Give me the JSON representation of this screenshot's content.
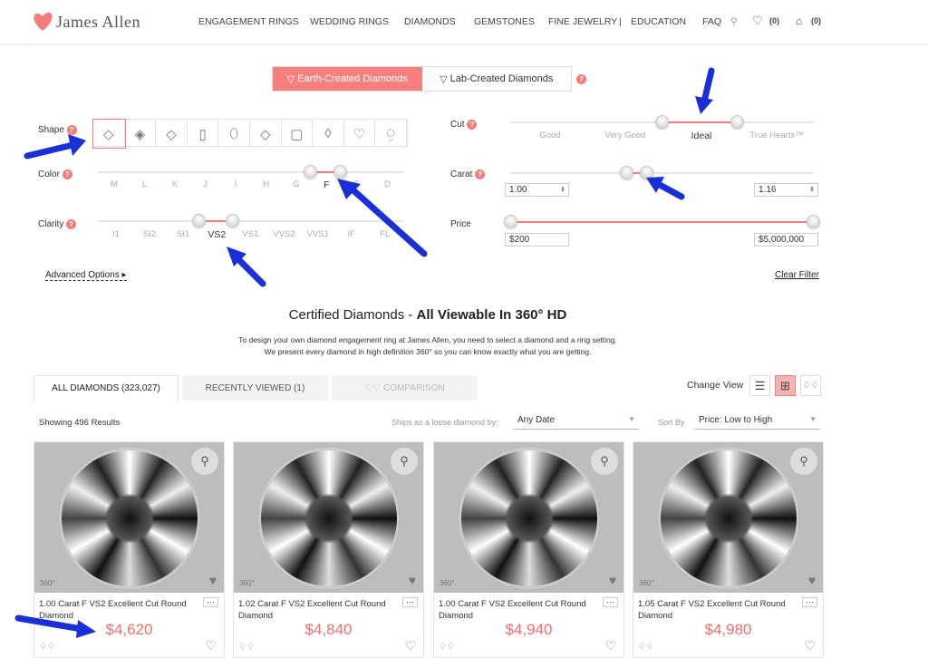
{
  "header": {
    "logo": "James Allen",
    "nav": [
      "ENGAGEMENT RINGS",
      "WEDDING RINGS",
      "DIAMONDS",
      "GEMSTONES",
      "FINE JEWELRY",
      "|",
      "EDUCATION",
      "FAQ"
    ],
    "wishlist_count": "(0)",
    "cart_count": "(0)"
  },
  "toggle": {
    "earth": "Earth-Created Diamonds",
    "lab": "Lab-Created Diamonds",
    "selected": "earth"
  },
  "filters": {
    "shape": {
      "label": "Shape",
      "selected": "Round",
      "icons": [
        "round",
        "princess",
        "cushion",
        "emerald",
        "oval",
        "asscher",
        "radiant",
        "marquise",
        "heart",
        "pear"
      ]
    },
    "color": {
      "label": "Color",
      "ticks": [
        "M",
        "L",
        "K",
        "J",
        "I",
        "H",
        "G",
        "F",
        "E",
        "D"
      ],
      "active": "F",
      "range": [
        "F",
        "F"
      ]
    },
    "clarity": {
      "label": "Clarity",
      "ticks": [
        "I1",
        "SI2",
        "SI1",
        "VS2",
        "VS1",
        "VVS2",
        "VVS1",
        "IF",
        "FL"
      ],
      "active": "VS2",
      "range": [
        "VS2",
        "VS2"
      ]
    },
    "cut": {
      "label": "Cut",
      "ticks": [
        "Good",
        "Very Good",
        "Ideal",
        "True Hearts™"
      ],
      "active": "Ideal"
    },
    "carat": {
      "label": "Carat",
      "min": "1.00",
      "max": "1.16"
    },
    "price": {
      "label": "Price",
      "min": "$200",
      "max": "$5,000,000"
    },
    "advanced": "Advanced Options ▸",
    "clear": "Clear Filter"
  },
  "section": {
    "title_plain": "Certified Diamonds - ",
    "title_bold": "All Viewable In 360° HD",
    "desc1": "To design your own diamond engagement ring at James Allen, you need to select a diamond and a ring setting.",
    "desc2": "We present every diamond in high definition 360° so you can know exactly what you are getting."
  },
  "tabs": [
    "ALL DIAMONDS (323,027)",
    "RECENTLY VIEWED (1)",
    "♡♡ COMPARISON"
  ],
  "view": {
    "label": "Change View",
    "selected": "grid"
  },
  "results": {
    "showing": "Showing 496 Results",
    "ships_label": "Ships as a loose diamond by:",
    "ships_value": "Any Date",
    "sort_label": "Sort By",
    "sort_value": "Price: Low to High"
  },
  "cards": [
    {
      "title": "1.00 Carat F VS2 Excellent Cut Round Diamond",
      "price": "$4,620"
    },
    {
      "title": "1.02 Carat F VS2 Excellent Cut Round Diamond",
      "price": "$4,840"
    },
    {
      "title": "1.00 Carat F VS2 Excellent Cut Round Diamond",
      "price": "$4,940"
    },
    {
      "title": "1.05 Carat F VS2 Excellent Cut Round Diamond",
      "price": "$4,980"
    }
  ],
  "colors": {
    "accent": "#f27d7a",
    "annotation_arrow": "#1a2fd6"
  }
}
